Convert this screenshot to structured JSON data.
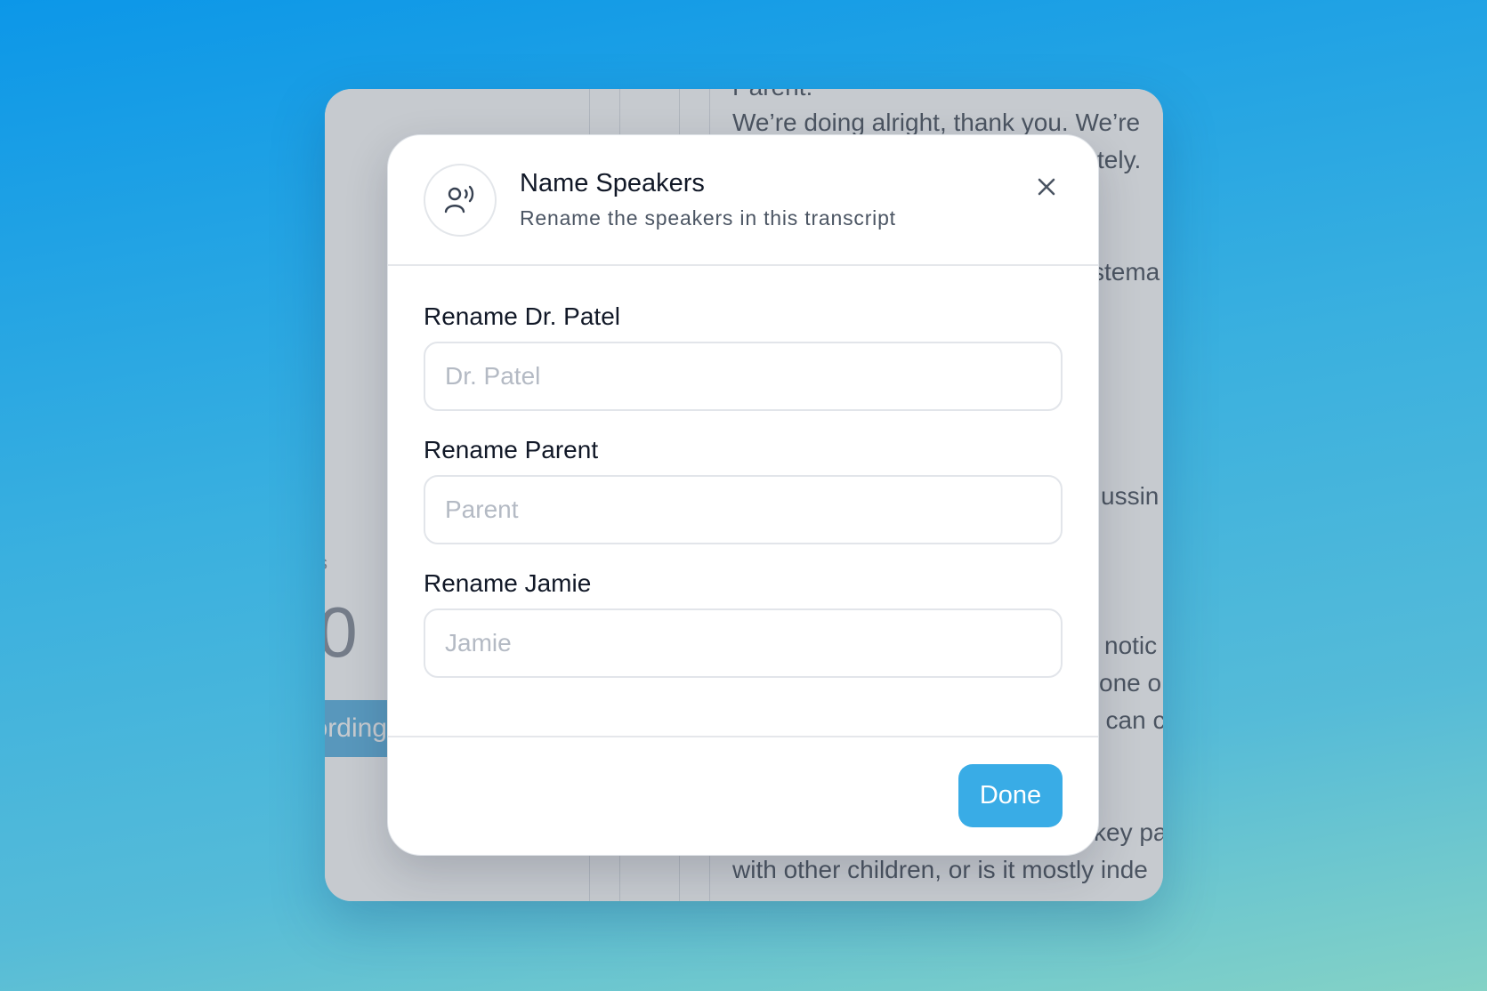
{
  "background_app": {
    "timer_text": ":0",
    "small_mark": "s",
    "record_button_label": "ording",
    "transcript_lines": [
      "Parent:",
      "We’re doing alright, thank you. We’re",
      "tely.",
      "stema",
      "ussin",
      "notic",
      "one o",
      "t can c",
      "key pa",
      "with other children, or is it mostly inde"
    ]
  },
  "modal": {
    "icon": "speaker-person-icon",
    "title": "Name Speakers",
    "subtitle": "Rename the speakers in this transcript",
    "close_icon": "close-icon",
    "fields": [
      {
        "label": "Rename Dr. Patel",
        "placeholder": "Dr. Patel",
        "value": ""
      },
      {
        "label": "Rename Parent",
        "placeholder": "Parent",
        "value": ""
      },
      {
        "label": "Rename Jamie",
        "placeholder": "Jamie",
        "value": ""
      }
    ],
    "done_label": "Done"
  },
  "colors": {
    "accent": "#39ace6",
    "background_top": "#0c97e8",
    "background_bottom": "#84d2c6"
  }
}
